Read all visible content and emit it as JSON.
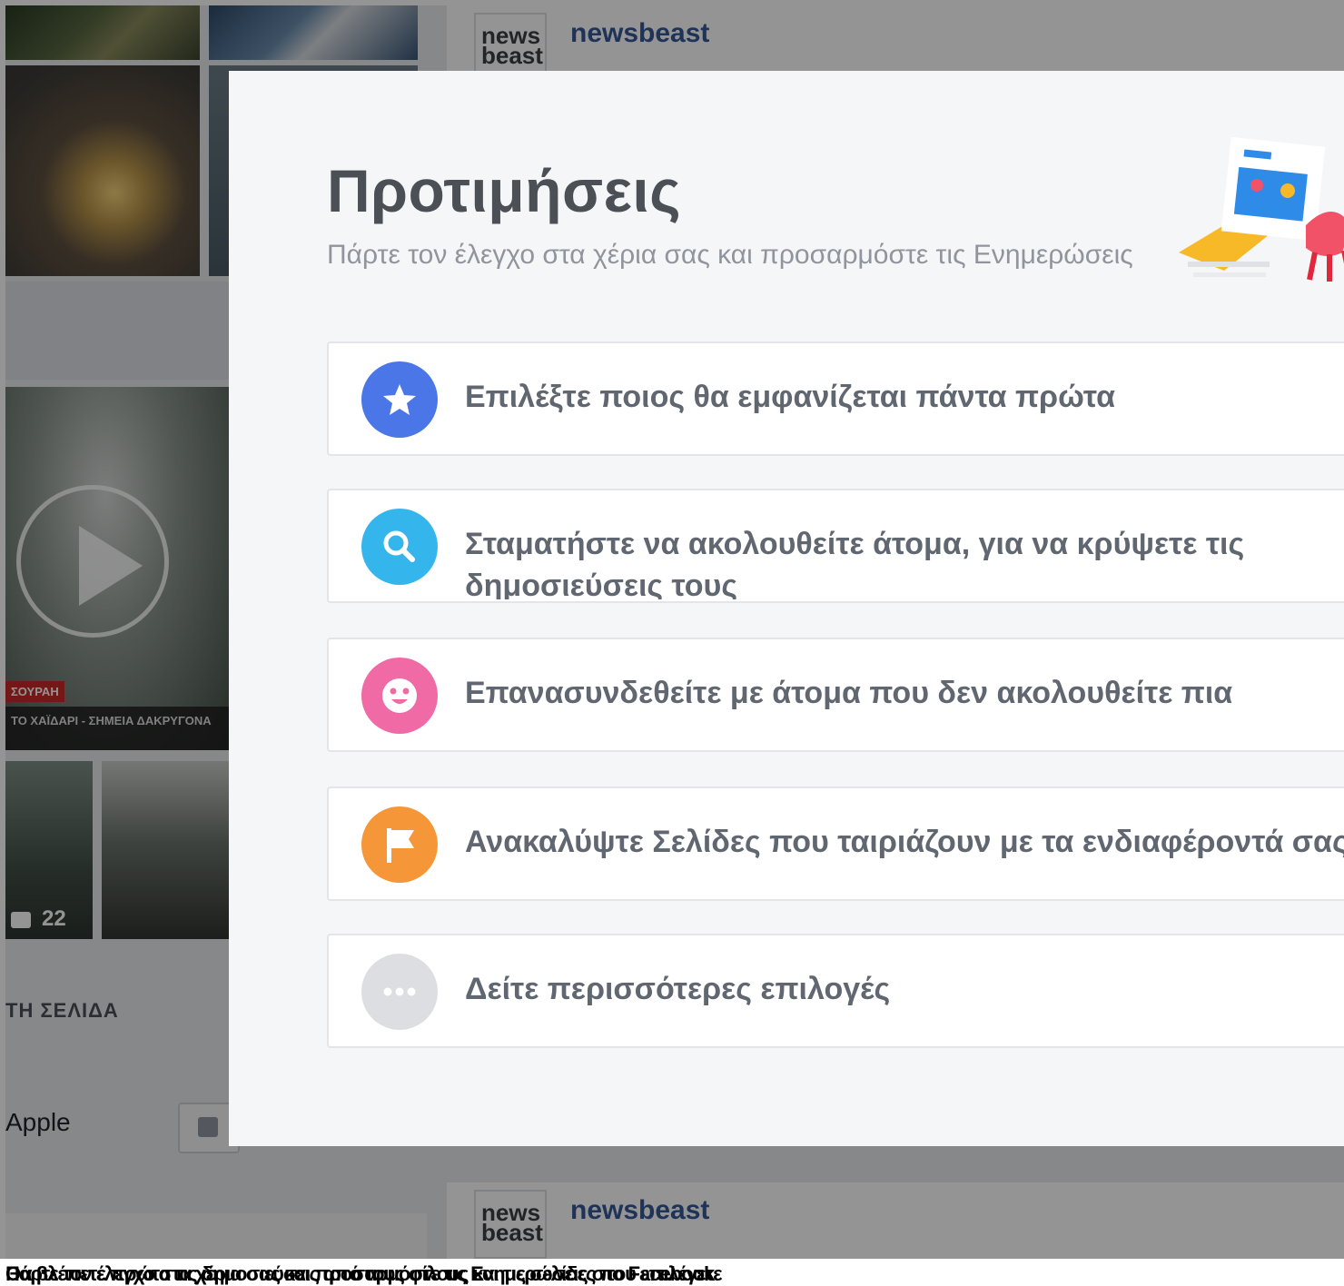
{
  "background": {
    "left_column": {
      "video_badge": "ΣΟΥΡΑΗ",
      "video_caption": "ΤΟ ΧΑΪΔΑΡΙ - ΣΗΜΕΙΑ ΔΑΚΡΥΓΟΝΑ",
      "comment_count": "22",
      "section_heading": "ΤΗ ΣΕΛΙΔΑ",
      "page_name": "Apple"
    },
    "feed": {
      "post1_logo": "news beast",
      "post1_name": "newsbeast",
      "post2_logo": "news beast",
      "post2_name": "newsbeast"
    }
  },
  "dialog": {
    "title": "Προτιμήσεις",
    "subtitle": "Πάρτε τον έλεγχο στα χέρια σας και προσαρμόστε τις Ενημερώσεις",
    "options": [
      {
        "label": "Επιλέξτε ποιος θα εμφανίζεται πάντα πρώτα",
        "icon": "star-icon",
        "color": "#4a76e8"
      },
      {
        "label": "Σταματήστε να ακολουθείτε άτομα, για να κρύψετε τις δημοσιεύσεις τους",
        "icon": "search-icon",
        "color": "#34b6ec"
      },
      {
        "label": "Επανασυνδεθείτε με άτομα που δεν ακολουθείτε πια",
        "icon": "smiley-icon",
        "color": "#f06aa6"
      },
      {
        "label": "Ανακαλύψτε Σελίδες που ταιριάζουν με τα ενδιαφέροντά σας",
        "icon": "flag-icon",
        "color": "#f59638"
      },
      {
        "label": "Δείτε περισσότερες επιλογές",
        "icon": "more-icon",
        "color": "#dcdee2"
      }
    ]
  },
  "caption_lines": [
    "Θα βλέπετε πρώτα τις δημοσιεύσεις από τους φίλους και τις σελίδες που επιλέγετε",
    "Πάρτε τον έλεγχο στα χέρια σας και προσαρμόστε τις Ενημερώσεις στο Facebook"
  ]
}
